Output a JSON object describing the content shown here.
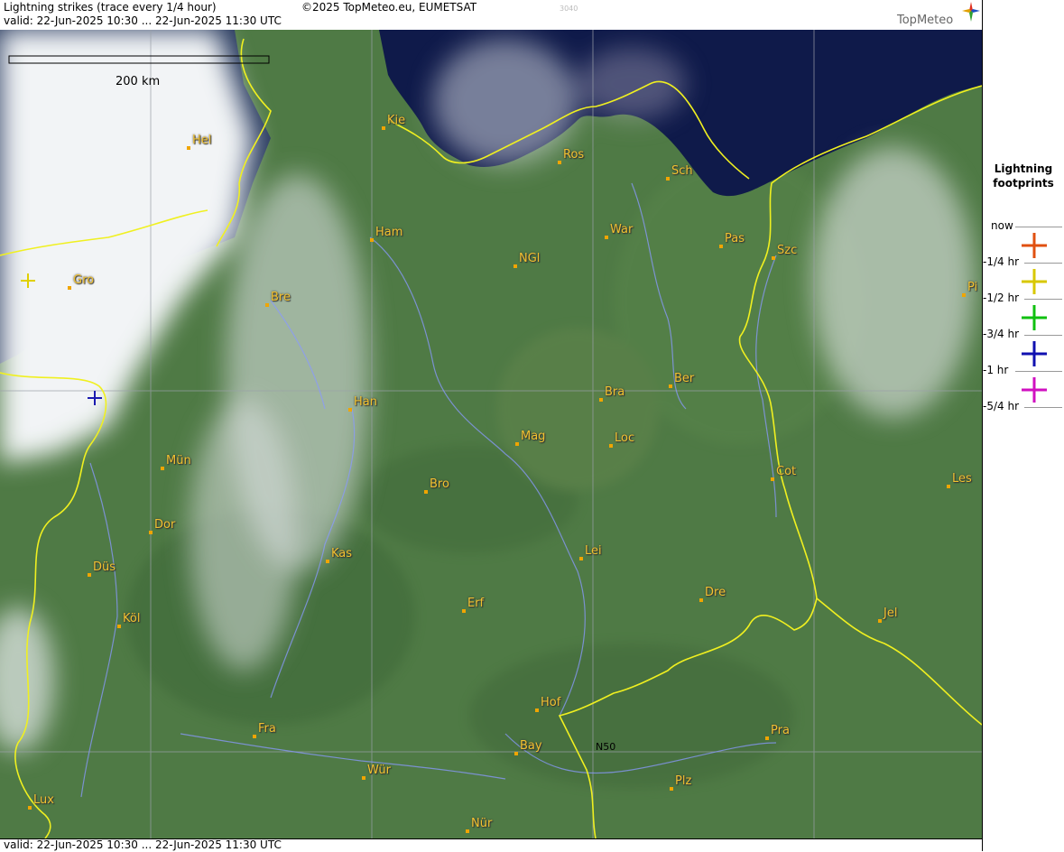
{
  "header": {
    "title": "Lightning strikes (trace every 1/4 hour)",
    "copyright": "©2025 TopMeteo.eu, EUMETSAT",
    "code": "3040",
    "valid": "valid:  22-Jun-2025 10:30 ... 22-Jun-2025 11:30 UTC",
    "logo_text": "TopMeteo"
  },
  "footer": {
    "valid": "valid:  22-Jun-2025 10:30 ... 22-Jun-2025 11:30 UTC"
  },
  "scale": {
    "label": "200 km"
  },
  "grid_label": "N50",
  "cities": [
    {
      "name": "Kie"
    },
    {
      "name": "Hel"
    },
    {
      "name": "Ros"
    },
    {
      "name": "Sch"
    },
    {
      "name": "Ham"
    },
    {
      "name": "War"
    },
    {
      "name": "Pas"
    },
    {
      "name": "Szc"
    },
    {
      "name": "NGl"
    },
    {
      "name": "Gro"
    },
    {
      "name": "Bre"
    },
    {
      "name": "Pi"
    },
    {
      "name": "Ber"
    },
    {
      "name": "Bra"
    },
    {
      "name": "Han"
    },
    {
      "name": "Mag"
    },
    {
      "name": "Loc"
    },
    {
      "name": "Mün"
    },
    {
      "name": "Cot"
    },
    {
      "name": "Les"
    },
    {
      "name": "Bro"
    },
    {
      "name": "Dor"
    },
    {
      "name": "Kas"
    },
    {
      "name": "Lei"
    },
    {
      "name": "Düs"
    },
    {
      "name": "Dre"
    },
    {
      "name": "Erf"
    },
    {
      "name": "Köl"
    },
    {
      "name": "Jel"
    },
    {
      "name": "Hof"
    },
    {
      "name": "Fra"
    },
    {
      "name": "Pra"
    },
    {
      "name": "Bay"
    },
    {
      "name": "Wür"
    },
    {
      "name": "Plz"
    },
    {
      "name": "Lux"
    },
    {
      "name": "Nür"
    }
  ],
  "strikes": [
    {
      "age": "-1/2 hr",
      "color": "#e0d000"
    },
    {
      "age": "-1 hr",
      "color": "#1a1ab0"
    }
  ],
  "legend": {
    "title": "Lightning footprints",
    "items": [
      {
        "label": "now",
        "color": "#e05010"
      },
      {
        "label": "-1/4 hr",
        "color": "#d8c800"
      },
      {
        "label": "-1/2 hr",
        "color": "#10c010"
      },
      {
        "label": "-3/4 hr",
        "color": "#1010b0"
      },
      {
        "label": "-1 hr",
        "color": "#d010c0"
      },
      {
        "label": "-5/4 hr",
        "color": ""
      }
    ]
  },
  "colors": {
    "land": "#4f7a45",
    "sea": "#0f1a4a",
    "border": "#f0f020",
    "river": "#8090ff",
    "city_label": "#f2c230",
    "cloud": "#e8ecef"
  }
}
